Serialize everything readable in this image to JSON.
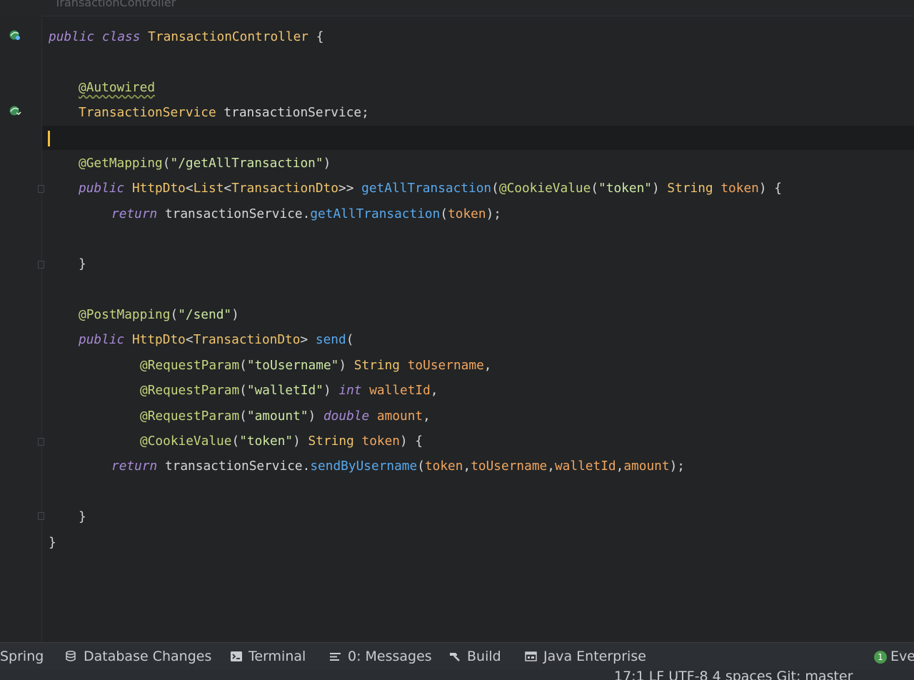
{
  "breadcrumb": {
    "text": "TransactionController"
  },
  "editor": {
    "lines": [
      [
        [
          "k",
          "public class "
        ],
        [
          "ty",
          "TransactionController "
        ],
        [
          "pu",
          "{"
        ]
      ],
      [],
      [
        [
          "an",
          "@Autowired"
        ]
      ],
      [
        [
          "ty",
          "TransactionService "
        ],
        [
          "pu",
          "transactionService;"
        ]
      ],
      [],
      [
        [
          "an",
          "@GetMapping"
        ],
        [
          "pu",
          "("
        ],
        [
          "st",
          "\"/getAllTransaction\""
        ],
        [
          "pu",
          ")"
        ]
      ],
      [
        [
          "k",
          "public "
        ],
        [
          "ty",
          "HttpDto"
        ],
        [
          "pu",
          "<"
        ],
        [
          "ty",
          "List"
        ],
        [
          "pu",
          "<"
        ],
        [
          "ty",
          "TransactionDto"
        ],
        [
          "pu",
          ">> "
        ],
        [
          "fn",
          "getAllTransaction"
        ],
        [
          "pu",
          "("
        ],
        [
          "an",
          "@CookieValue"
        ],
        [
          "pu",
          "("
        ],
        [
          "st",
          "\"token\""
        ],
        [
          "pu",
          ") "
        ],
        [
          "ty",
          "String "
        ],
        [
          "pr",
          "token"
        ],
        [
          "pu",
          ") {"
        ]
      ],
      [
        [
          "k",
          "return "
        ],
        [
          "pu",
          "transactionService."
        ],
        [
          "fn",
          "getAllTransaction"
        ],
        [
          "pu",
          "("
        ],
        [
          "pr",
          "token"
        ],
        [
          "pu",
          ");"
        ]
      ],
      [],
      [
        [
          "pu",
          "}"
        ]
      ],
      [],
      [
        [
          "an",
          "@PostMapping"
        ],
        [
          "pu",
          "("
        ],
        [
          "st",
          "\"/send\""
        ],
        [
          "pu",
          ")"
        ]
      ],
      [
        [
          "k",
          "public "
        ],
        [
          "ty",
          "HttpDto"
        ],
        [
          "pu",
          "<"
        ],
        [
          "ty",
          "TransactionDto"
        ],
        [
          "pu",
          "> "
        ],
        [
          "fn",
          "send"
        ],
        [
          "pu",
          "("
        ]
      ],
      [
        [
          "an",
          "@RequestParam"
        ],
        [
          "pu",
          "("
        ],
        [
          "st",
          "\"toUsername\""
        ],
        [
          "pu",
          ") "
        ],
        [
          "ty",
          "String "
        ],
        [
          "pr",
          "toUsername"
        ],
        [
          "pu",
          ","
        ]
      ],
      [
        [
          "an",
          "@RequestParam"
        ],
        [
          "pu",
          "("
        ],
        [
          "st",
          "\"walletId\""
        ],
        [
          "pu",
          ") "
        ],
        [
          "k",
          "int "
        ],
        [
          "pr",
          "walletId"
        ],
        [
          "pu",
          ","
        ]
      ],
      [
        [
          "an",
          "@RequestParam"
        ],
        [
          "pu",
          "("
        ],
        [
          "st",
          "\"amount\""
        ],
        [
          "pu",
          ") "
        ],
        [
          "k",
          "double "
        ],
        [
          "pr",
          "amount"
        ],
        [
          "pu",
          ","
        ]
      ],
      [
        [
          "an",
          "@CookieValue"
        ],
        [
          "pu",
          "("
        ],
        [
          "st",
          "\"token\""
        ],
        [
          "pu",
          ") "
        ],
        [
          "ty",
          "String "
        ],
        [
          "pr",
          "token"
        ],
        [
          "pu",
          ") {"
        ]
      ],
      [
        [
          "k",
          "return "
        ],
        [
          "pu",
          "transactionService."
        ],
        [
          "fn",
          "sendByUsername"
        ],
        [
          "pu",
          "("
        ],
        [
          "pr",
          "token"
        ],
        [
          "pu",
          ","
        ],
        [
          "pr",
          "toUsername"
        ],
        [
          "pu",
          ","
        ],
        [
          "pr",
          "walletId"
        ],
        [
          "pu",
          ","
        ],
        [
          "pr",
          "amount"
        ],
        [
          "pu",
          ");"
        ]
      ],
      [],
      [
        [
          "pu",
          "}"
        ]
      ],
      [
        [
          "pu",
          "}"
        ]
      ]
    ]
  },
  "toolbar": {
    "spring": "Spring",
    "database_changes": "Database Changes",
    "terminal": "Terminal",
    "messages": "0: Messages",
    "build": "Build",
    "java_enterprise": "Java Enterprise",
    "event_count": "1",
    "event_log": "Eve"
  },
  "statusbar": {
    "text": "17:1   LF   UTF-8   4 spaces   Git: master"
  },
  "colors": {
    "background": "#222426",
    "keyword": "#a98ad6",
    "type": "#f0c46b",
    "annotation": "#c6d67e",
    "string": "#cfe8a3",
    "method": "#5aa9ee",
    "param": "#f2a65e",
    "caret": "#f0c040"
  }
}
